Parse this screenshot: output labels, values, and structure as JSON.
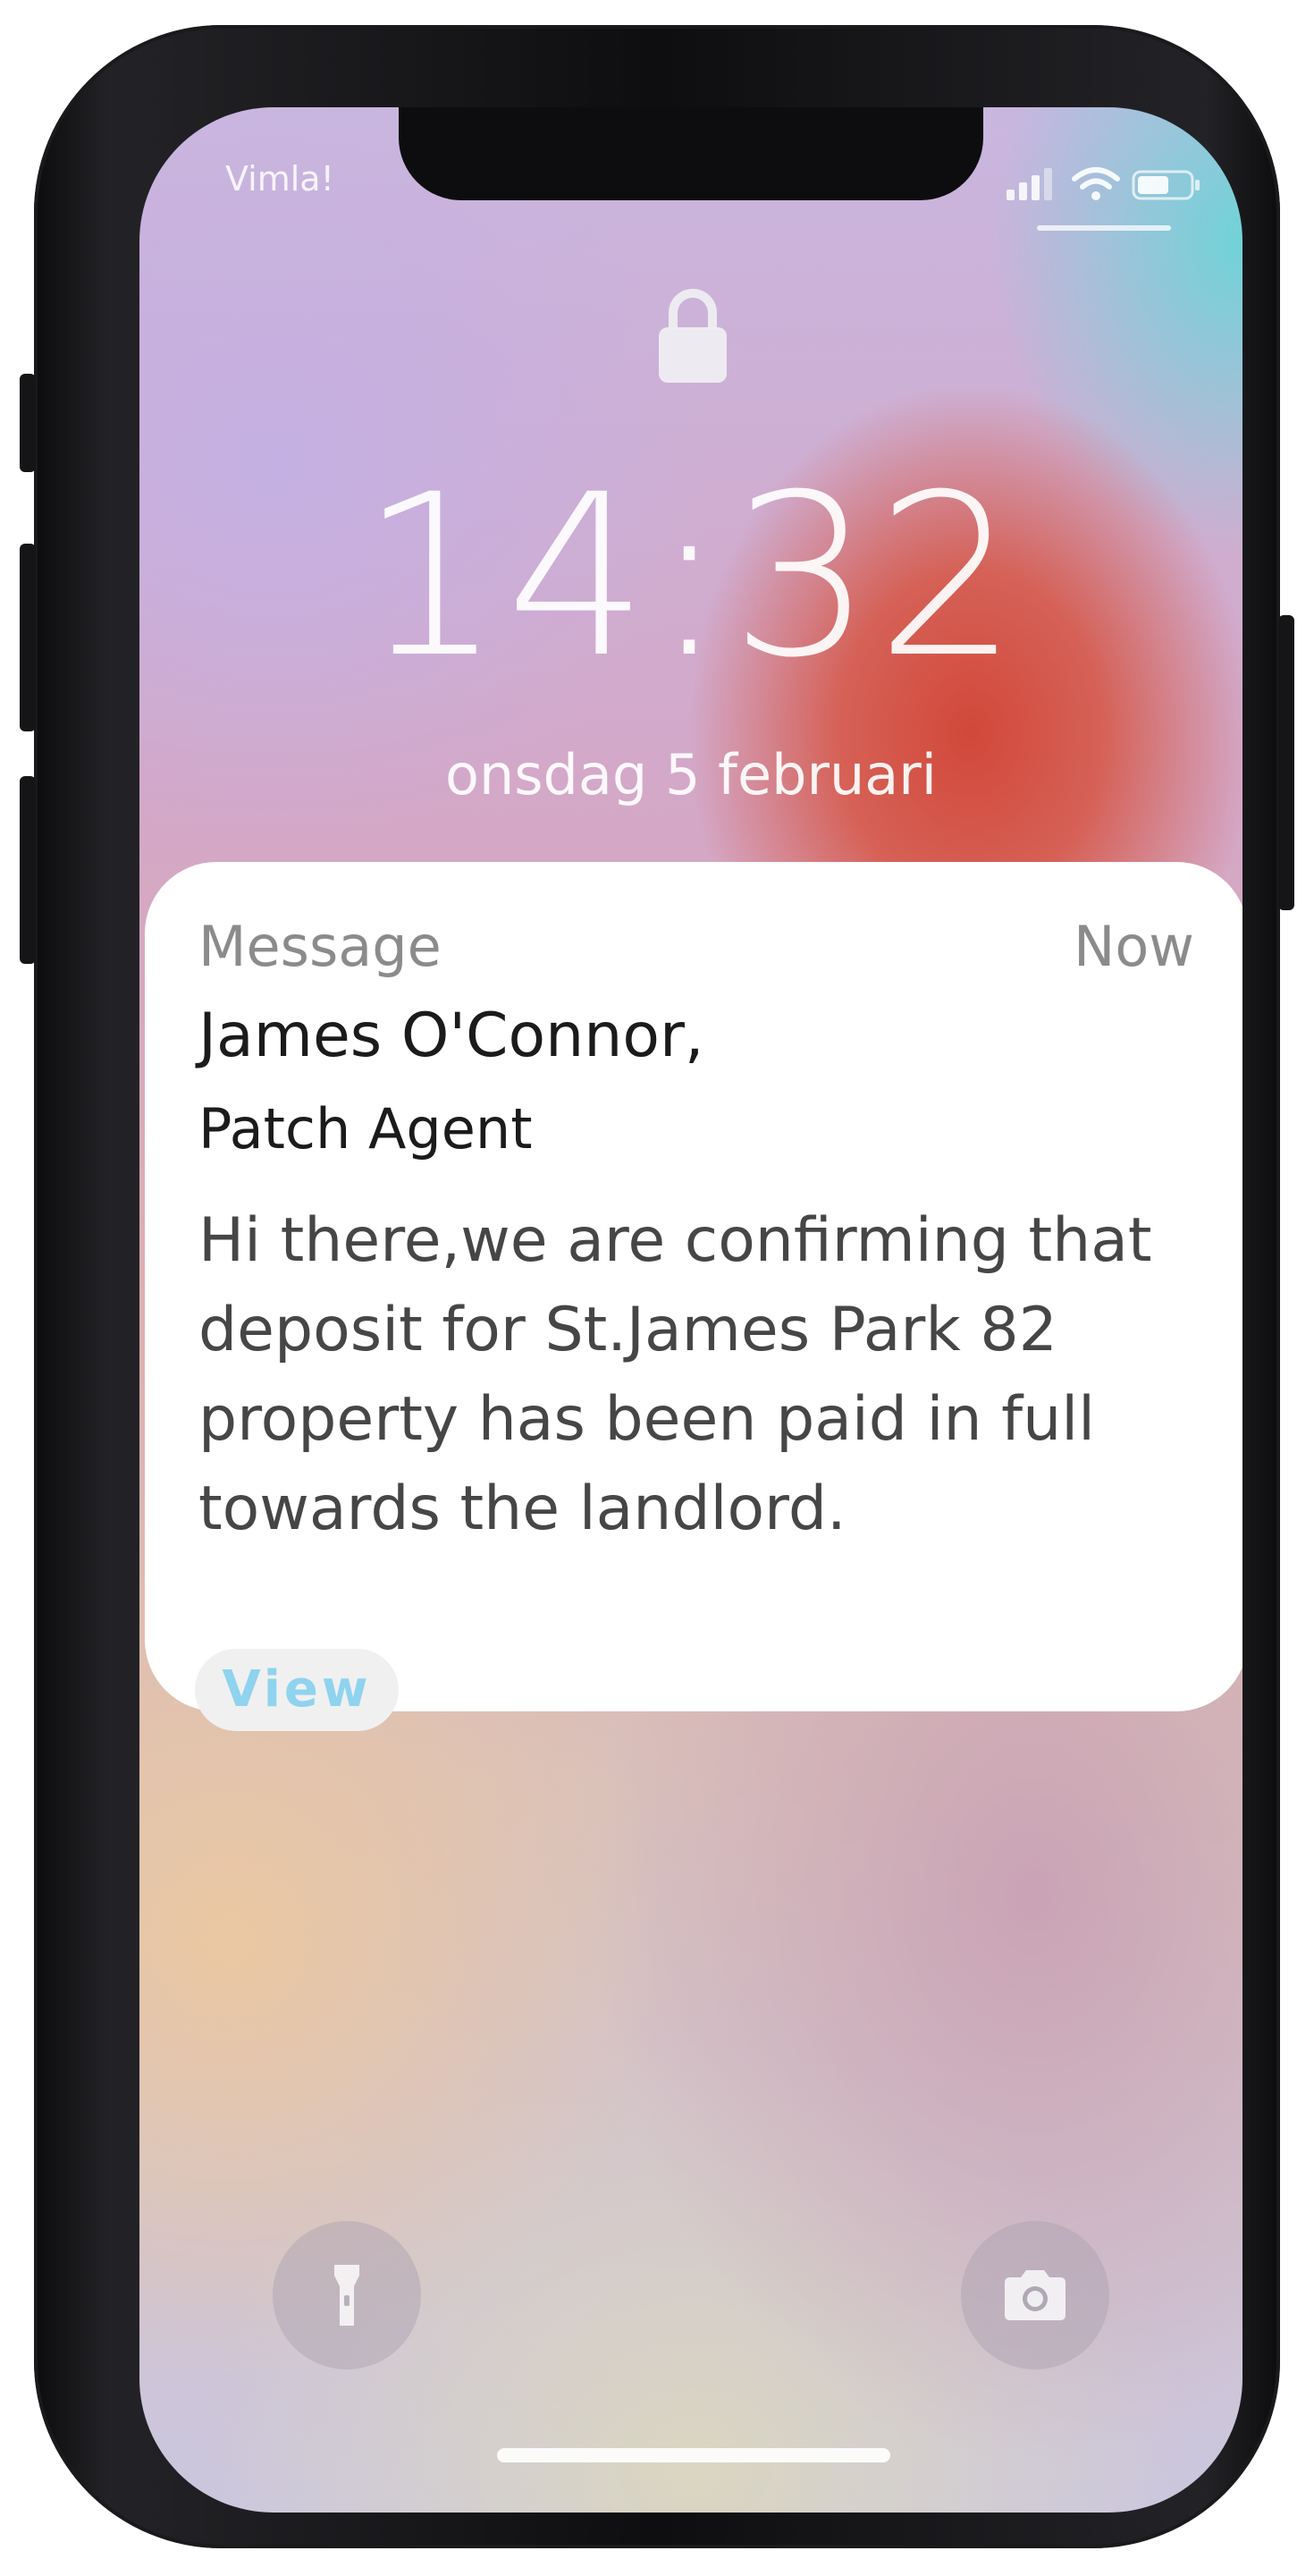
{
  "status_bar": {
    "carrier": "Vimla!",
    "icons": [
      "signal-icon",
      "wifi-icon",
      "battery-icon"
    ]
  },
  "lock_screen": {
    "time": "14:32",
    "date": "onsdag 5 februari"
  },
  "notification": {
    "app": "Message",
    "time": "Now",
    "sender": "James O'Connor,",
    "sender_role": "Patch Agent",
    "body": "Hi there,we are confirming that deposit for St.James Park 82 property has been paid in full towards the landlord.",
    "action_label": "View"
  },
  "quick_actions": {
    "left_icon": "flashlight-icon",
    "right_icon": "camera-icon"
  },
  "colors": {
    "accent_text": "#8fd3ee",
    "card_bg": "#ffffff",
    "muted_text": "#8b8b8b"
  }
}
